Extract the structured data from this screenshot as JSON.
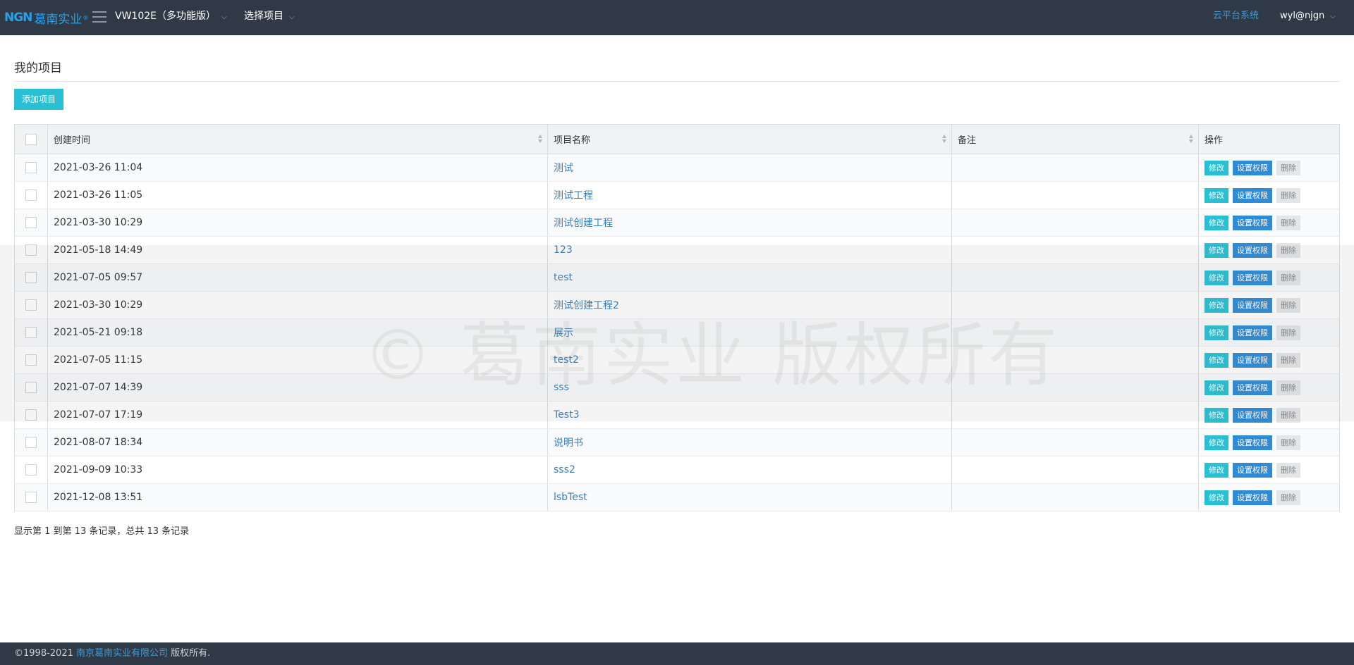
{
  "header": {
    "logo_mark": "NGN",
    "logo_text": "葛南实业",
    "logo_reg": "®",
    "device": "VW102E（多功能版）",
    "project_menu": "选择项目",
    "cloud_link": "云平台系统",
    "user": "wyl@njgn"
  },
  "page": {
    "title": "我的项目",
    "add_button": "添加项目"
  },
  "table": {
    "columns": [
      "创建时间",
      "项目名称",
      "备注",
      "操作"
    ],
    "actions": [
      "修改",
      "设置权限",
      "删除"
    ],
    "rows": [
      {
        "time": "2021-03-26 11:04",
        "name": "测试",
        "note": ""
      },
      {
        "time": "2021-03-26 11:05",
        "name": "测试工程",
        "note": ""
      },
      {
        "time": "2021-03-30 10:29",
        "name": "测试创建工程",
        "note": ""
      },
      {
        "time": "2021-05-18 14:49",
        "name": "123",
        "note": ""
      },
      {
        "time": "2021-07-05 09:57",
        "name": "test",
        "note": ""
      },
      {
        "time": "2021-03-30 10:29",
        "name": "测试创建工程2",
        "note": ""
      },
      {
        "time": "2021-05-21 09:18",
        "name": "展示",
        "note": ""
      },
      {
        "time": "2021-07-05 11:15",
        "name": "test2",
        "note": ""
      },
      {
        "time": "2021-07-07 14:39",
        "name": "sss",
        "note": ""
      },
      {
        "time": "2021-07-07 17:19",
        "name": "Test3",
        "note": ""
      },
      {
        "time": "2021-08-07 18:34",
        "name": "说明书",
        "note": ""
      },
      {
        "time": "2021-09-09 10:33",
        "name": "sss2",
        "note": ""
      },
      {
        "time": "2021-12-08 13:51",
        "name": "lsbTest",
        "note": ""
      }
    ]
  },
  "pagination": {
    "summary": "显示第 1 到第 13 条记录，总共 13 条记录"
  },
  "watermark": "©   葛南实业 版权所有",
  "footer": {
    "prefix": "©1998-2021 ",
    "company": "南京葛南实业有限公司",
    "suffix": " 版权所有."
  },
  "colors": {
    "topbar": "#2f3a46",
    "accent_teal": "#29c0d3",
    "accent_blue": "#2e8bd5",
    "link": "#3a7fb8"
  }
}
